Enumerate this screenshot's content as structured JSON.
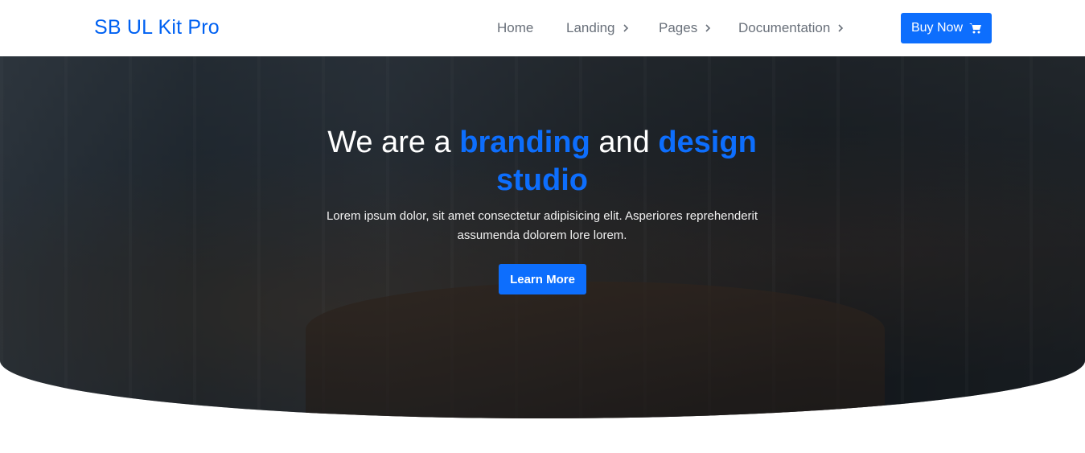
{
  "brand": "SB UL Kit Pro",
  "nav": {
    "home": "Home",
    "landing": "Landing",
    "pages": "Pages",
    "documentation": "Documentation",
    "buy_now": "Buy Now"
  },
  "hero": {
    "headline_part1": "We are a ",
    "headline_highlight1": "branding",
    "headline_part2": " and ",
    "headline_highlight2": "design studio",
    "subtext": "Lorem ipsum dolor, sit amet consectetur adipisicing elit. Asperiores reprehenderit assumenda dolorem lore lorem.",
    "cta": "Learn More"
  },
  "colors": {
    "accent": "#0d6efd",
    "brand": "#0061f2",
    "nav_text": "#69707a"
  },
  "icons": {
    "cart": "cart-icon",
    "chevron": "chevron-right-icon"
  }
}
